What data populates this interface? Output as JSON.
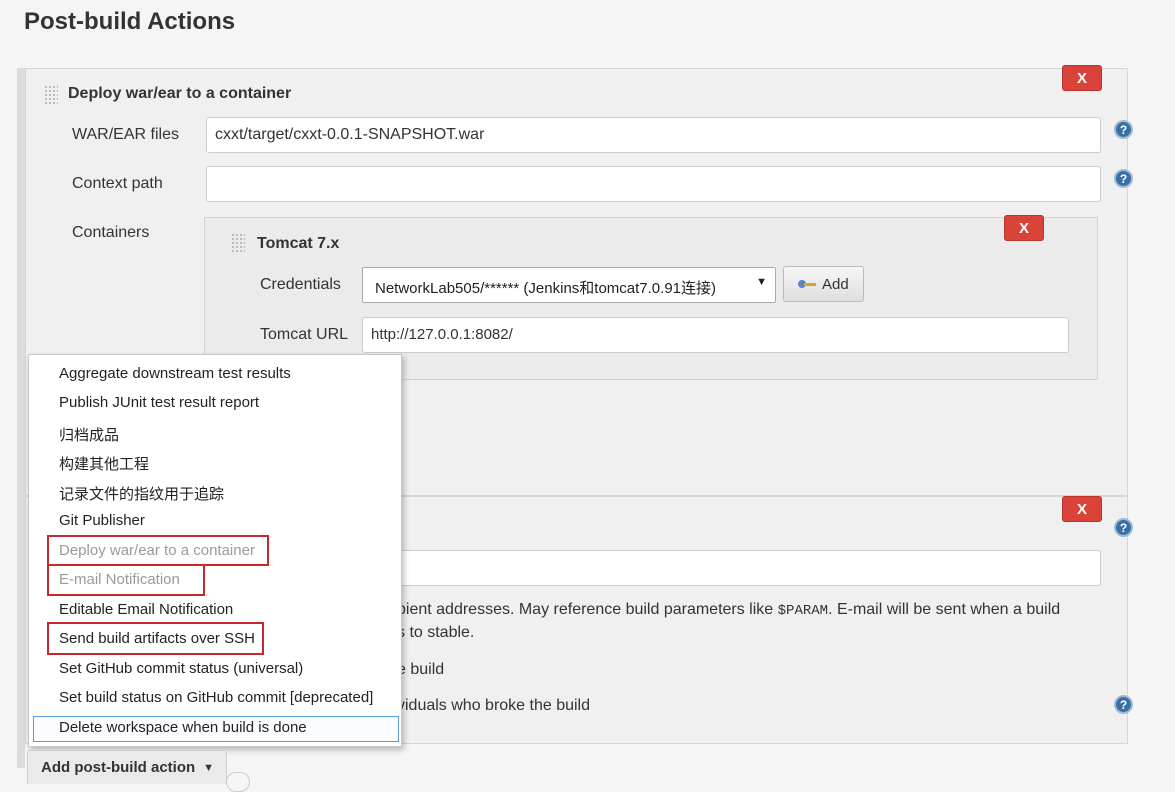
{
  "page_title": "Post-build Actions",
  "deploy_section": {
    "title": "Deploy war/ear to a container",
    "remove_label": "X",
    "war_ear_files_label": "WAR/EAR files",
    "war_ear_files_value": "cxxt/target/cxxt-0.0.1-SNAPSHOT.war",
    "context_path_label": "Context path",
    "context_path_value": "",
    "containers_label": "Containers",
    "help_label": "?",
    "tomcat": {
      "title": "Tomcat 7.x",
      "remove_label": "X",
      "credentials_label": "Credentials",
      "credentials_selected": "NetworkLab505/****** (Jenkins和tomcat7.0.91连接)",
      "add_button_label": "Add",
      "tomcat_url_label": "Tomcat URL",
      "tomcat_url_value": "http://127.0.0.1:8082/"
    }
  },
  "email_section": {
    "remove_label": "X",
    "help_label": "?",
    "recipients_value": "",
    "desc_part1": "pient addresses. May reference build parameters like ",
    "desc_param": "$PARAM",
    "desc_part2": ". E-mail will be sent when a build",
    "desc_line2": "s to stable.",
    "option1_tail": "e build",
    "option2_tail": "viduals who broke the build"
  },
  "dropdown_menu": {
    "items": [
      {
        "label": "Aggregate downstream test results",
        "disabled": false
      },
      {
        "label": "Publish JUnit test result report",
        "disabled": false
      },
      {
        "label": "归档成品",
        "disabled": false
      },
      {
        "label": "构建其他工程",
        "disabled": false
      },
      {
        "label": "记录文件的指纹用于追踪",
        "disabled": false
      },
      {
        "label": "Git Publisher",
        "disabled": false
      },
      {
        "label": "Deploy war/ear to a container",
        "disabled": true
      },
      {
        "label": "E-mail Notification",
        "disabled": true
      },
      {
        "label": "Editable Email Notification",
        "disabled": false
      },
      {
        "label": "Send build artifacts over SSH",
        "disabled": false
      },
      {
        "label": "Set GitHub commit status (universal)",
        "disabled": false
      },
      {
        "label": "Set build status on GitHub commit [deprecated]",
        "disabled": false
      },
      {
        "label": "Delete workspace when build is done",
        "disabled": false
      }
    ],
    "highlighted_color": "#c9262d"
  },
  "add_post_build_action_label": "Add post-build action",
  "colors": {
    "remove_button": "#d9433a",
    "help_icon": "#3a6fa6",
    "selection_border": "#5b9bd5"
  }
}
